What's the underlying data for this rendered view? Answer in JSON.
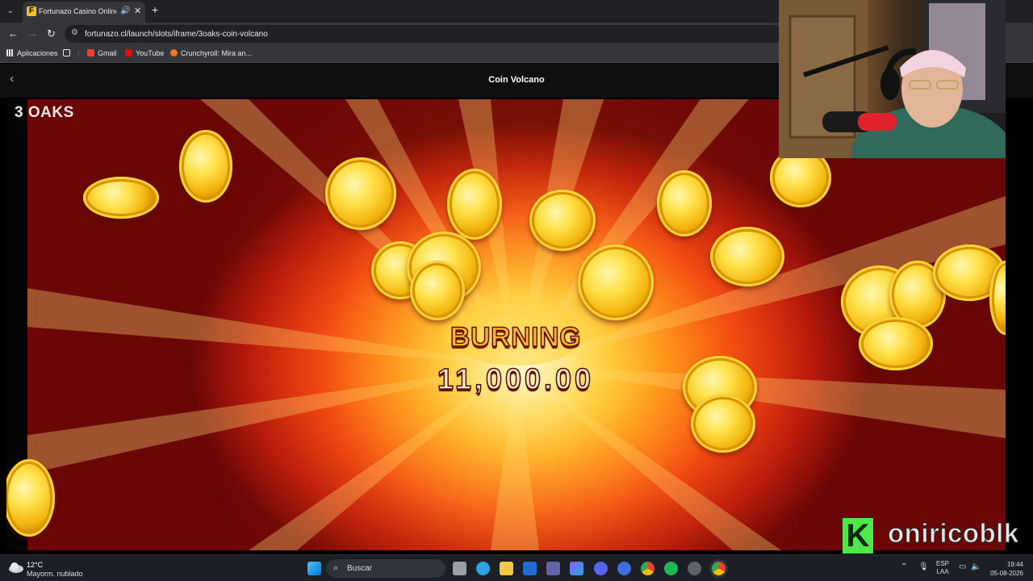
{
  "browser": {
    "tab": {
      "title": "Fortunazo Casino Online | T",
      "favicon": "F"
    },
    "url": "fortunazo.cl/launch/slots/iframe/3oaks-coin-volcano",
    "bookmarks": [
      {
        "label": "Aplicaciones",
        "icon": "apps-grid-icon"
      },
      {
        "label": "Gmail",
        "icon": "gmail-icon"
      },
      {
        "label": "YouTube",
        "icon": "youtube-icon"
      },
      {
        "label": "Crunchyroll: Mira an...",
        "icon": "crunchyroll-icon"
      }
    ]
  },
  "page": {
    "title": "Coin Volcano"
  },
  "game": {
    "provider_logo": "3 OAKS",
    "banner": "BURNING",
    "amount": "11,000.00",
    "colors": {
      "gold": "#ffd23a",
      "red": "#e63a10"
    }
  },
  "overlay": {
    "channel": "onirico blk",
    "channel_display": "oniricoblk",
    "badge": "K",
    "badge_color": "#4ee84a"
  },
  "taskbar": {
    "weather": {
      "temp": "12°C",
      "desc": "Mayorm. nublado"
    },
    "search_placeholder": "Buscar",
    "lang": {
      "line1": "ESP",
      "line2": "LAA"
    },
    "clock": {
      "time": "19:44",
      "date": "05-08-2026"
    }
  }
}
